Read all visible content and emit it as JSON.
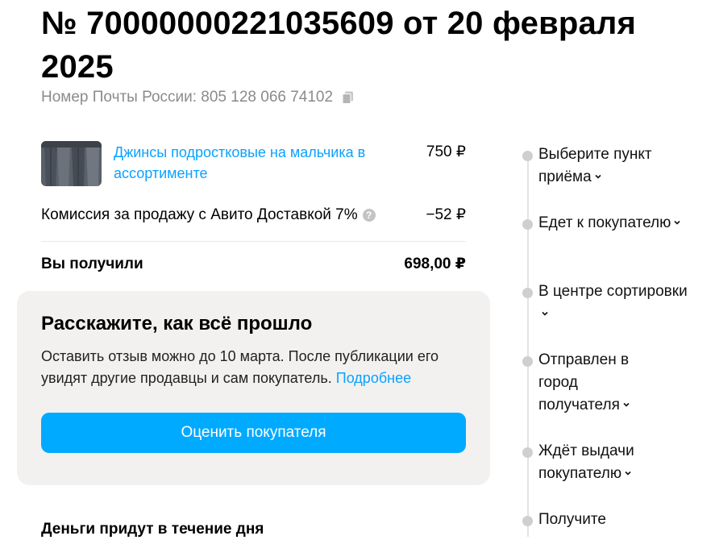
{
  "order": {
    "title": "№ 70000000221035609 от 20 февраля 2025",
    "tracking_label": "Номер Почты России: 805 128 066 74102"
  },
  "item": {
    "name": "Джинсы подростковые на мальчика в ассортименте",
    "price": "750 ₽"
  },
  "fee": {
    "label": "Комиссия за продажу с Авито Доставкой 7%",
    "value": "−52 ₽"
  },
  "total": {
    "label": "Вы получили",
    "value": "698,00 ₽"
  },
  "review": {
    "title": "Расскажите, как всё прошло",
    "text": "Оставить отзыв можно до 10 марта. После публикации его увидят другие продавцы и сам покупатель.",
    "link": "Подробнее",
    "button": "Оценить покупателя"
  },
  "money_heading": "Деньги придут в течение дня",
  "timeline": [
    {
      "label": "Выберите пункт приёма"
    },
    {
      "label": "Едет к покупателю"
    },
    {
      "label": "В центре сортировки"
    },
    {
      "label": "Отправлен в город получателя"
    },
    {
      "label": "Ждёт выдачи покупателю"
    },
    {
      "label": "Получите"
    }
  ],
  "colors": {
    "accent": "#00aaff",
    "link": "#0ba1ff",
    "card_bg": "#f2f1f0",
    "muted": "#8b8b8b"
  }
}
